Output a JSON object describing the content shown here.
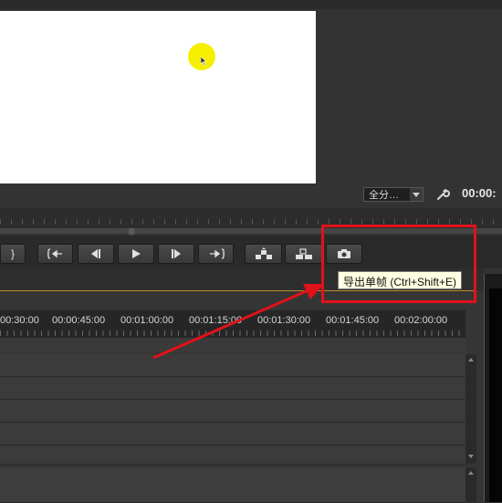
{
  "monitor": {
    "zoom_label": "全分…",
    "timecode": "00:00:"
  },
  "tooltip": {
    "text": "导出单帧 (Ctrl+Shift+E)"
  },
  "transport": {
    "mark_out": "}",
    "buttons": [
      "go-to-in-point",
      "step-back",
      "play",
      "step-forward",
      "go-to-out-point",
      "lift",
      "extract",
      "export-frame"
    ]
  },
  "timeline": {
    "ruler_labels": [
      "00:30:00",
      "00:00:45:00",
      "00:01:00:00",
      "00:01:15:00",
      "00:01:30:00",
      "00:01:45:00",
      "00:02:00:00"
    ]
  },
  "colors": {
    "annotation": "#e0121a",
    "cursor_highlight": "#f5f000",
    "tooltip_bg": "#ffffe1"
  }
}
